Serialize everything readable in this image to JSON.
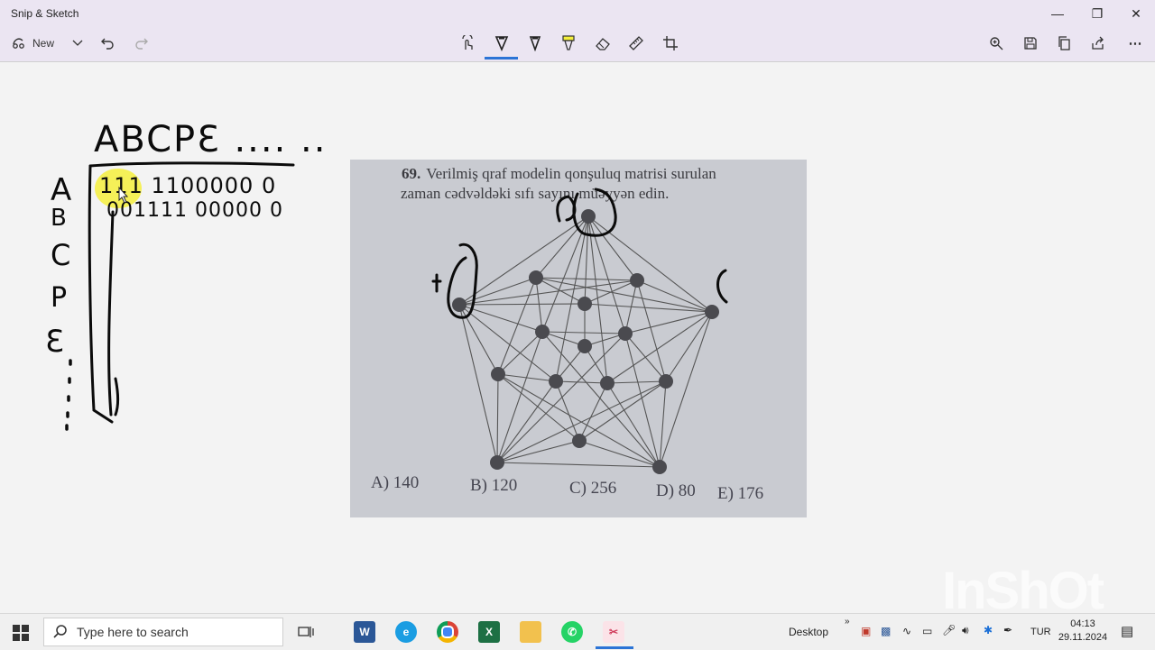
{
  "app": {
    "title": "Snip & Sketch"
  },
  "toolbar": {
    "new_label": "New",
    "tools": [
      "touch-writing-icon",
      "ballpoint-pen-icon",
      "pencil-icon",
      "highlighter-icon",
      "eraser-icon",
      "ruler-icon",
      "crop-icon"
    ],
    "right_tools": [
      "zoom-icon",
      "save-icon",
      "copy-icon",
      "share-icon",
      "more-icon"
    ]
  },
  "question": {
    "number": "69.",
    "line1": "Verilmiş qraf modelin qonşuluq matrisi surulan",
    "line2": "zaman cədvəldəki sıfı                 sayını müəyyən edin.",
    "answers": [
      "A) 140",
      "B) 120",
      "C) 256",
      "D) 80",
      "E) 176"
    ]
  },
  "handwriting": {
    "header": "ABCPƐ .... ..",
    "rowA": "111 1100000 0",
    "rowB": "001111 00000 0",
    "side": [
      "A",
      "B",
      "C",
      "P",
      "Ɛ"
    ]
  },
  "watermark": "InShOt",
  "taskbar": {
    "search_placeholder": "Type here to search",
    "apps": [
      "task-view-icon",
      "word-icon",
      "edge-icon",
      "chrome-icon",
      "excel-icon",
      "file-explorer-icon",
      "whatsapp-icon",
      "snip-sketch-icon"
    ],
    "desktop_label": "Desktop",
    "lang": "TUR",
    "time": "04:13",
    "date": "29.11.2024"
  },
  "colors": {
    "titlebar": "#ebe5f2",
    "accent": "#2b74d6",
    "photo_bg": "#c9cbd1",
    "ink_black": "#0b0b0b",
    "ink_blue": "#1d3fd6",
    "highlight": "#f4ef3c"
  }
}
